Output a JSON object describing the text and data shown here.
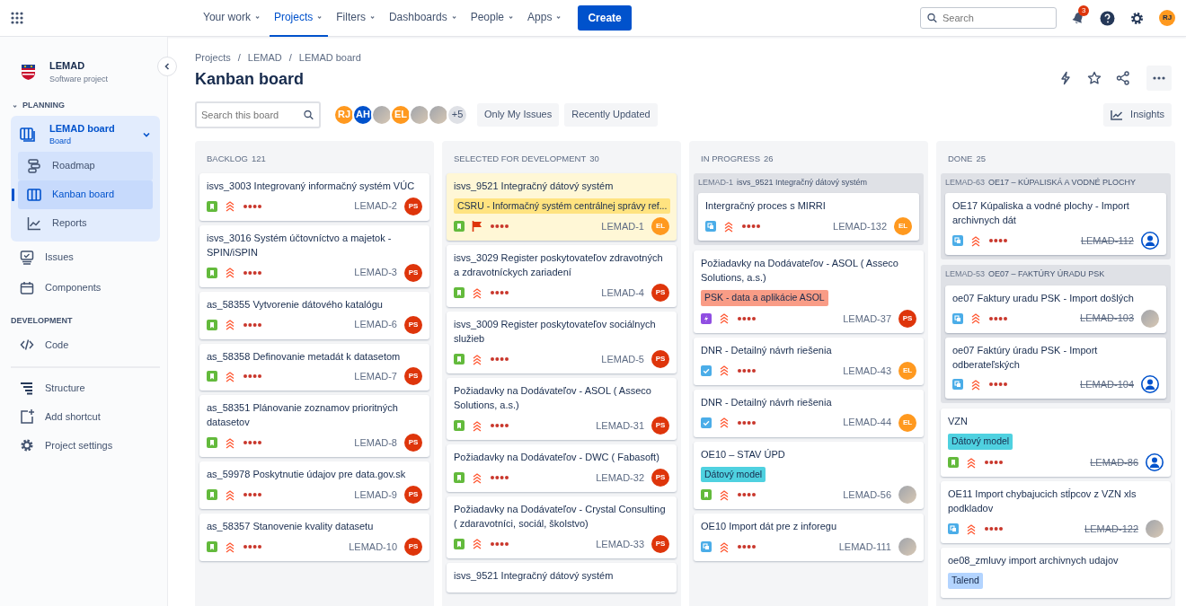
{
  "top_nav": {
    "items": [
      {
        "label": "Your work",
        "selected": false
      },
      {
        "label": "Projects",
        "selected": true
      },
      {
        "label": "Filters",
        "selected": false
      },
      {
        "label": "Dashboards",
        "selected": false
      },
      {
        "label": "People",
        "selected": false
      },
      {
        "label": "Apps",
        "selected": false
      }
    ],
    "create": "Create",
    "search": {
      "placeholder": "Search"
    },
    "notifications": "3",
    "user": "RJ"
  },
  "sidebar": {
    "project": {
      "name": "LEMAD",
      "subtitle": "Software project"
    },
    "sections": [
      {
        "title": "PLANNING",
        "expanded": true,
        "board": {
          "name": "LEMAD board",
          "subtitle": "Board",
          "expanded": true,
          "children": [
            {
              "label": "Roadmap",
              "selected": false
            },
            {
              "label": "Kanban board",
              "selected": true
            },
            {
              "label": "Reports",
              "selected": false
            }
          ]
        },
        "items": [
          {
            "label": "Issues",
            "selected": false
          },
          {
            "label": "Components",
            "selected": false
          }
        ]
      },
      {
        "title": "DEVELOPMENT",
        "items": [
          {
            "label": "Code",
            "selected": false
          }
        ]
      }
    ],
    "footer_items": [
      "Structure",
      "Add shortcut",
      "Project settings"
    ]
  },
  "breadcrumbs": [
    {
      "label": "Projects"
    },
    {
      "separator": "/",
      "label": "LEMAD"
    },
    {
      "separator": "/",
      "label": "LEMAD board"
    }
  ],
  "title": "Kanban board",
  "filters": {
    "search_placeholder": "Search this board",
    "avatars": [
      {
        "kind": "initials",
        "initials": "RJ",
        "color": "#ff991f"
      },
      {
        "kind": "initials",
        "initials": "AH",
        "color": "#0052cc"
      },
      {
        "kind": "photo"
      },
      {
        "kind": "initials",
        "initials": "EL",
        "color": "#ff991f"
      },
      {
        "kind": "photo"
      },
      {
        "kind": "photo"
      },
      {
        "kind": "more",
        "initials": "+5"
      }
    ],
    "buttons": [
      {
        "label": "Only My Issues",
        "selected": false
      },
      {
        "label": "Recently Updated",
        "selected": false
      }
    ],
    "insights": "Insights"
  },
  "columns": [
    {
      "title": "BACKLOG",
      "count": "121",
      "items": [
        {
          "kind": "story",
          "summary": "isvs_3003 Integrovaný informačný systém VÚC",
          "flagged": false,
          "key": "LEMAD-2",
          "assignee": {
            "kind": "initials",
            "initials": "PS",
            "color": "#de350b"
          }
        },
        {
          "kind": "story",
          "summary": "isvs_3016 Systém účtovníctvo a majetok - SPIN/iSPIN",
          "flagged": false,
          "key": "LEMAD-3",
          "assignee": {
            "kind": "initials",
            "initials": "PS",
            "color": "#de350b"
          }
        },
        {
          "kind": "story",
          "summary": "as_58355 Vytvorenie dátového katalógu",
          "flagged": false,
          "key": "LEMAD-6",
          "assignee": {
            "kind": "initials",
            "initials": "PS",
            "color": "#de350b"
          }
        },
        {
          "kind": "story",
          "summary": "as_58358 Definovanie metadát k datasetom",
          "flagged": false,
          "key": "LEMAD-7",
          "assignee": {
            "kind": "initials",
            "initials": "PS",
            "color": "#de350b"
          }
        },
        {
          "kind": "story",
          "summary": "as_58351 Plánovanie zoznamov prioritných datasetov",
          "flagged": false,
          "key": "LEMAD-8",
          "assignee": {
            "kind": "initials",
            "initials": "PS",
            "color": "#de350b"
          }
        },
        {
          "kind": "story",
          "summary": "as_59978 Poskytnutie údajov pre data.gov.sk",
          "flagged": false,
          "key": "LEMAD-9",
          "assignee": {
            "kind": "initials",
            "initials": "PS",
            "color": "#de350b"
          }
        },
        {
          "kind": "story",
          "summary": "as_58357 Stanovenie kvality datasetu",
          "flagged": false,
          "key": "LEMAD-10",
          "assignee": {
            "kind": "initials",
            "initials": "PS",
            "color": "#de350b"
          }
        }
      ]
    },
    {
      "title": "SELECTED FOR DEVELOPMENT",
      "count": "30",
      "items": [
        {
          "kind": "story",
          "summary": "isvs_9521 Integračný dátový systém",
          "label": {
            "text": "CSRU - Informačný systém centrálnej správy ref...",
            "color": "#ffe380"
          },
          "flagged": true,
          "key": "LEMAD-1",
          "assignee": {
            "kind": "initials",
            "initials": "EL",
            "color": "#ff991f"
          }
        },
        {
          "kind": "story",
          "summary": "isvs_3029 Register poskytovateľov zdravotných a zdravotníckych zariadení",
          "flagged": false,
          "key": "LEMAD-4",
          "assignee": {
            "kind": "initials",
            "initials": "PS",
            "color": "#de350b"
          }
        },
        {
          "kind": "story",
          "summary": "isvs_3009 Register poskytovateľov sociálnych služieb",
          "flagged": false,
          "key": "LEMAD-5",
          "assignee": {
            "kind": "initials",
            "initials": "PS",
            "color": "#de350b"
          }
        },
        {
          "kind": "story",
          "summary": "Požiadavky na Dodávateľov - ASOL ( Asseco Solutions, a.s.)",
          "flagged": false,
          "key": "LEMAD-31",
          "assignee": {
            "kind": "initials",
            "initials": "PS",
            "color": "#de350b"
          }
        },
        {
          "kind": "story",
          "summary": "Požiadavky na Dodávateľov - DWC ( Fabasoft)",
          "flagged": false,
          "key": "LEMAD-32",
          "assignee": {
            "kind": "initials",
            "initials": "PS",
            "color": "#de350b"
          }
        },
        {
          "kind": "story",
          "summary": "Požiadavky na Dodávateľov - Crystal Consulting ( zdaravotníci, sociál, školstvo)",
          "flagged": false,
          "key": "LEMAD-33",
          "assignee": {
            "kind": "initials",
            "initials": "PS",
            "color": "#de350b"
          }
        },
        {
          "kind": "plain",
          "summary": "isvs_9521 Integračný dátový systém"
        }
      ]
    },
    {
      "title": "IN PROGRESS",
      "count": "26",
      "items": [
        {
          "kind": "group",
          "key": "LEMAD-1",
          "title": "isvs_9521 Integračný dátový systém",
          "children": [
            {
              "kind": "subtask",
              "summary": "Intergračný proces s MIRRI",
              "flagged": false,
              "key": "LEMAD-132",
              "assignee": {
                "kind": "initials",
                "initials": "EL",
                "color": "#ff991f"
              }
            }
          ]
        },
        {
          "kind": "epic",
          "summary": "Požiadavky na Dodávateľov - ASOL ( Asseco Solutions, a.s.)",
          "label": {
            "text": "PSK - data a aplikácie ASOL",
            "color": "#f99c86"
          },
          "flagged": false,
          "key": "LEMAD-37",
          "assignee": {
            "kind": "initials",
            "initials": "PS",
            "color": "#de350b"
          }
        },
        {
          "kind": "task",
          "summary": "DNR - Detailný návrh riešenia",
          "flagged": false,
          "key": "LEMAD-43",
          "assignee": {
            "kind": "initials",
            "initials": "EL",
            "color": "#ff991f"
          }
        },
        {
          "kind": "task",
          "summary": "DNR - Detailný návrh riešenia",
          "flagged": false,
          "key": "LEMAD-44",
          "assignee": {
            "kind": "initials",
            "initials": "EL",
            "color": "#ff991f"
          }
        },
        {
          "kind": "story",
          "summary": "OE10 – STAV ÚPD",
          "label": {
            "text": "Dátový model",
            "color": "#4fd1e0"
          },
          "flagged": false,
          "key": "LEMAD-56",
          "assignee": {
            "kind": "photo"
          }
        },
        {
          "kind": "subtask",
          "summary": "OE10 Import dát pre z inforegu",
          "flagged": false,
          "key": "LEMAD-111",
          "assignee": {
            "kind": "photo"
          }
        }
      ]
    },
    {
      "title": "DONE",
      "count": "25",
      "items": [
        {
          "kind": "group",
          "key": "LEMAD-63",
          "title": "OE17 – KÚPALISKÁ A VODNÉ PLOCHY",
          "children": [
            {
              "kind": "subtask",
              "summary": "OE17 Kúpaliska a vodné plochy - Import archivnych dát",
              "flagged": false,
              "key": "LEMAD-112",
              "resolved": true,
              "assignee": {
                "kind": "unassigned"
              }
            }
          ]
        },
        {
          "kind": "group",
          "key": "LEMAD-53",
          "title": "OE07 – FAKTÚRY ÚRADU PSK",
          "children": [
            {
              "kind": "subtask",
              "summary": "oe07 Faktury uradu PSK - Import došlých",
              "flagged": false,
              "key": "LEMAD-103",
              "resolved": true,
              "assignee": {
                "kind": "photo"
              }
            },
            {
              "kind": "subtask",
              "summary": "oe07 Faktúry úradu PSK - Import odberateľských",
              "flagged": false,
              "key": "LEMAD-104",
              "resolved": true,
              "assignee": {
                "kind": "unassigned"
              }
            }
          ]
        },
        {
          "kind": "story",
          "summary": "VZN",
          "label": {
            "text": "Dátový model",
            "color": "#4fd1e0"
          },
          "flagged": false,
          "key": "LEMAD-86",
          "resolved": true,
          "assignee": {
            "kind": "unassigned"
          }
        },
        {
          "kind": "subtask",
          "summary": "OE11 Import chybajucich stĺpcov z VZN xls podkladov",
          "flagged": false,
          "key": "LEMAD-122",
          "resolved": true,
          "assignee": {
            "kind": "photo"
          }
        },
        {
          "kind": "plain",
          "summary": "oe08_zmluvy import archivnych udajov",
          "label": {
            "text": "Talend",
            "color": "#b3d4ff"
          }
        }
      ]
    }
  ]
}
